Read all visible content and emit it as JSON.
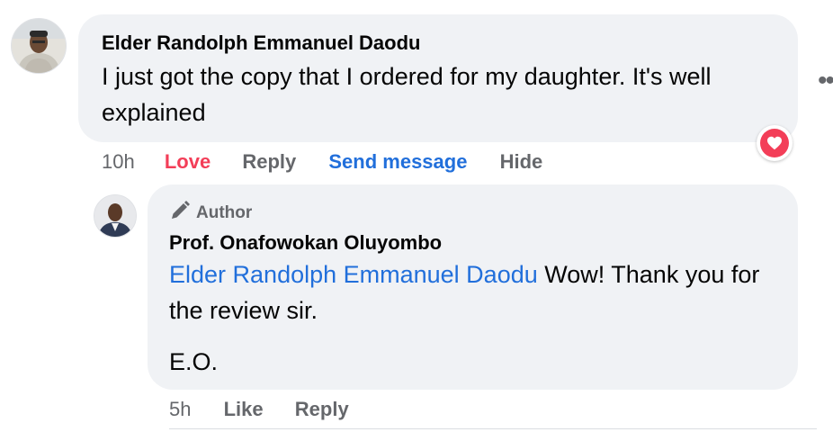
{
  "comment": {
    "author": "Elder Randolph Emmanuel Daodu",
    "text": "I just got the copy that I ordered for my daughter. It's well explained",
    "timestamp": "10h",
    "actions": {
      "love": "Love",
      "reply": "Reply",
      "send_message": "Send message",
      "hide": "Hide"
    },
    "reaction_icon": "heart-icon",
    "reaction_color": "#f33e58"
  },
  "reply": {
    "badge": "Author",
    "badge_icon": "pen-icon",
    "author": "Prof. Onafowokan Oluyombo",
    "mention": "Elder Randolph Emmanuel Daodu",
    "text": " Wow! Thank you for the review sir.",
    "signature": "E.O.",
    "timestamp": "5h",
    "actions": {
      "like": "Like",
      "reply": "Reply"
    }
  },
  "colors": {
    "bubble": "#f0f2f5",
    "link": "#216fdb",
    "love": "#f33e58",
    "secondary_text": "#65676b"
  }
}
